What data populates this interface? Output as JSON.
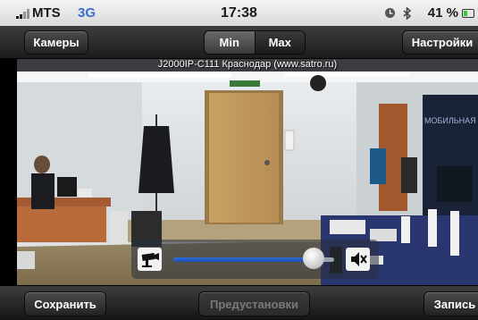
{
  "status_bar": {
    "carrier": "MTS",
    "network": "3G",
    "time": "17:38",
    "battery_percent_label": "41 %",
    "battery_level": 0.41,
    "battery_color": "#33cc33",
    "icons": [
      "signal-icon",
      "clock-icon",
      "bluetooth-icon",
      "battery-icon"
    ]
  },
  "nav": {
    "cameras_label": "Камеры",
    "settings_label": "Настройки",
    "segments": [
      {
        "label": "Min",
        "selected": true
      },
      {
        "label": "Max",
        "selected": false
      }
    ]
  },
  "video": {
    "osd_text": "J2000IP-C111  Краснодар  (www.satro.ru)",
    "scene_sign": "МОБИЛЬНАЯ"
  },
  "volume": {
    "level": 0.87,
    "left_icon": "camera-icon",
    "right_icon": "speaker-mute-icon"
  },
  "toolbar": {
    "save_label": "Сохранить",
    "presets_label": "Предустановки",
    "presets_enabled": false,
    "record_label": "Запись"
  }
}
